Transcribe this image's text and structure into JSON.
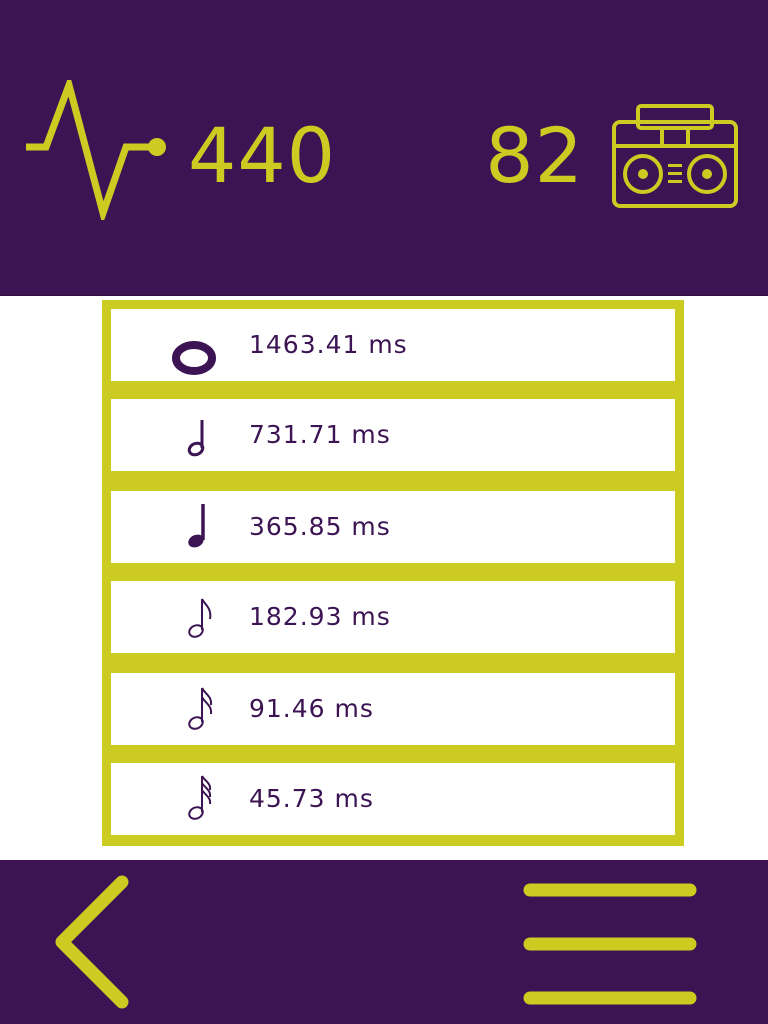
{
  "header": {
    "frequency": "440",
    "frequency_icon": "pulse-wave-icon",
    "tempo": "82",
    "tempo_icon": "boombox-icon"
  },
  "durations": [
    {
      "note": "whole-note",
      "label": "1463.41 ms"
    },
    {
      "note": "half-note",
      "label": "731.71 ms"
    },
    {
      "note": "quarter-note",
      "label": "365.85 ms"
    },
    {
      "note": "eighth-note",
      "label": "182.93 ms"
    },
    {
      "note": "sixteenth-note",
      "label": "91.46 ms"
    },
    {
      "note": "thirty-second-note",
      "label": "45.73 ms"
    }
  ],
  "footer": {
    "back_icon": "chevron-left-icon",
    "menu_icon": "hamburger-menu-icon"
  },
  "colors": {
    "primary": "#3c1453",
    "accent": "#cccb22",
    "surface": "#ffffff"
  }
}
